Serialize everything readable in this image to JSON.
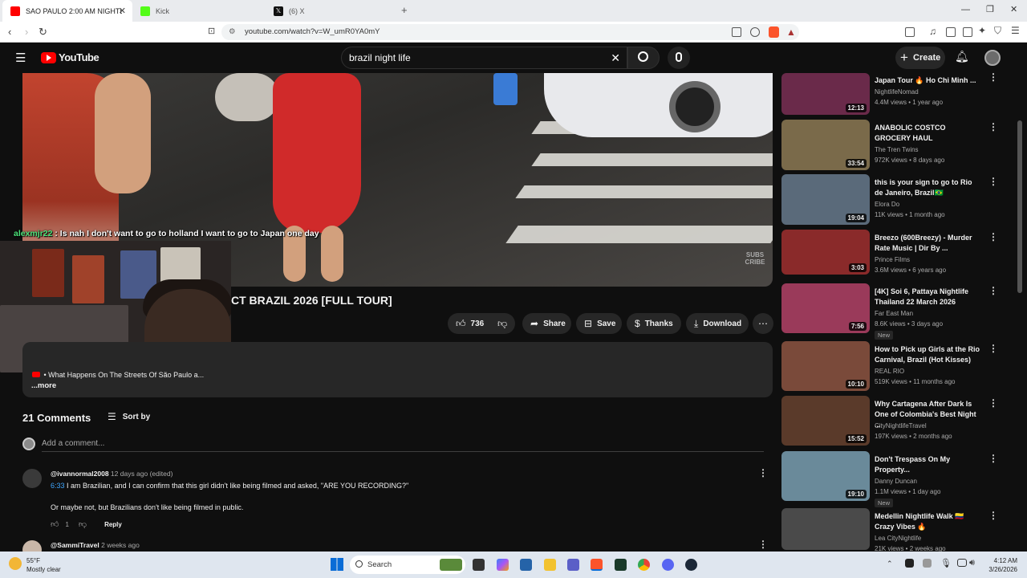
{
  "browser": {
    "tabs": [
      {
        "label": "SAO PAULO 2:00 AM NIGHTL",
        "active": true
      },
      {
        "label": "Kick",
        "active": false
      },
      {
        "label": "(6) X",
        "active": false
      }
    ],
    "url": "youtube.com/watch?v=W_umR0YA0mY",
    "colors": {
      "youtube_red": "#ff0000",
      "kick_green": "#53fc18"
    }
  },
  "youtube": {
    "logo": "YouTube",
    "search_query": "brazil night life",
    "create_label": "Create"
  },
  "video": {
    "chat_user": "alexmjr22",
    "chat_text": ": Is nah I don't want to go to holland I want to go to Japan one day",
    "subscribe_watermark": "SUBS CRIBE",
    "title_visible": "CT BRAZIL 2026 [FULL TOUR]"
  },
  "actions": {
    "likes": "736",
    "share": "Share",
    "save": "Save",
    "thanks": "Thanks",
    "download": "Download"
  },
  "description": {
    "line": "• What Happens On The Streets Of São Paulo a...",
    "more": "...more"
  },
  "comments": {
    "count_label": "21 Comments",
    "sort_label": "Sort by",
    "add_placeholder": "Add a comment...",
    "items": [
      {
        "user": "@ivannormal2008",
        "time": "12 days ago (edited)",
        "timestamp_link": "6:33",
        "text1": "I am Brazilian, and I can confirm that this girl didn't like being filmed and asked, \"ARE YOU RECORDING?\"",
        "text2": "Or maybe not, but Brazilians don't like being filmed in public.",
        "likes": "1",
        "reply": "Reply"
      },
      {
        "user": "@SammiTravel",
        "time": "2 weeks ago"
      }
    ]
  },
  "sidebar": [
    {
      "title": "Japan Tour 🔥 Ho Chi Minh ...",
      "channel": "NightlifeNomad",
      "meta": "4.4M views • 1 year ago",
      "duration": "12:13",
      "color": "#6a2a4a"
    },
    {
      "title": "ANABOLIC COSTCO GROCERY HAUL",
      "channel": "The Tren Twins",
      "meta": "972K views • 8 days ago",
      "duration": "33:54",
      "color": "#7a6a4a"
    },
    {
      "title": "this is your sign to go to Rio de Janeiro, Brazil🇧🇷",
      "channel": "Elora Do",
      "meta": "11K views • 1 month ago",
      "duration": "19:04",
      "color": "#5a6a7a"
    },
    {
      "title": "Breezo (600Breezy) - Murder Rate Music | Dir By ...",
      "channel": "Prince Films",
      "meta": "3.6M views • 6 years ago",
      "duration": "3:03",
      "color": "#8a2a2a"
    },
    {
      "title": "[4K] Soi 6, Pattaya Nightlife Thailand 22 March 2026",
      "channel": "Far East Man",
      "meta": "8.6K views • 3 days ago",
      "duration": "7:56",
      "badge": "New",
      "color": "#9a3a5a"
    },
    {
      "title": "How to Pick up Girls at the Rio Carnival, Brazil (Hot Kisses)",
      "channel": "REAL RIO",
      "meta": "519K views • 11 months ago",
      "duration": "10:10",
      "color": "#7a4a3a"
    },
    {
      "title": "Why Cartagena After Dark Is One of Colombia's Best Night ...",
      "channel": "CityNightlifeTravel",
      "meta": "197K views • 2 months ago",
      "duration": "15:52",
      "color": "#5a3a2a"
    },
    {
      "title": "Don't Trespass On My Property...",
      "channel": "Danny Duncan",
      "meta": "1.1M views • 1 day ago",
      "duration": "19:10",
      "badge": "New",
      "color": "#6a8a9a"
    },
    {
      "title": "Medellin Nightlife Walk 🇨🇴 Crazy Vibes 🔥",
      "channel": "Lea CityNightlife",
      "meta": "21K views • 2 weeks ago",
      "duration": "",
      "color": "#4a4a4a"
    }
  ],
  "taskbar": {
    "temp": "55°F",
    "weather": "Mostly clear",
    "search": "Search",
    "time": "4:12 AM",
    "date": "3/26/2026"
  }
}
